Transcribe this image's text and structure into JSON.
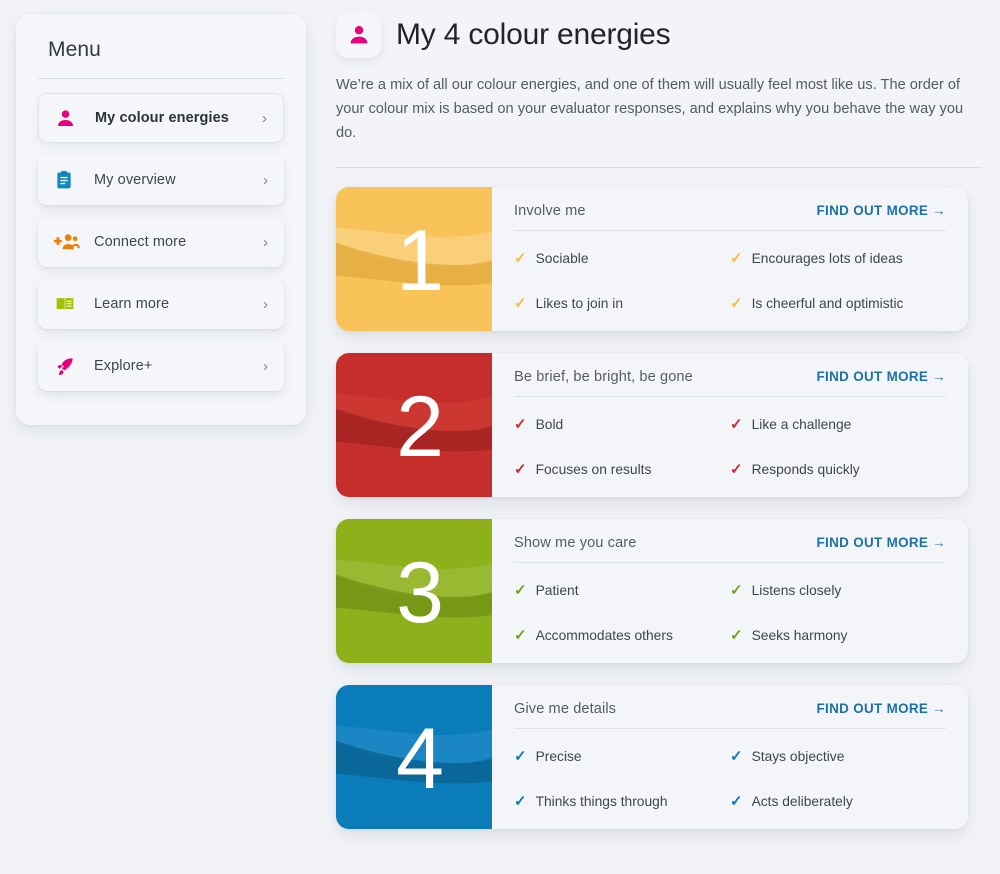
{
  "sidebar": {
    "title": "Menu",
    "items": [
      {
        "label": "My colour energies",
        "icon": "person-icon",
        "color": "#e6007e",
        "active": true,
        "chevron": "›"
      },
      {
        "label": "My overview",
        "icon": "clipboard-icon",
        "color": "#1287c0",
        "active": false,
        "chevron": "›"
      },
      {
        "label": "Connect more",
        "icon": "add-people-icon",
        "color": "#ef7d00",
        "active": false,
        "chevron": "›"
      },
      {
        "label": "Learn more",
        "icon": "open-book-icon",
        "color": "#a6bf00",
        "active": false,
        "chevron": "›"
      },
      {
        "label": "Explore+",
        "icon": "rocket-icon",
        "color": "#e6007e",
        "active": false,
        "chevron": "›"
      }
    ]
  },
  "header": {
    "badge_icon": "person-icon",
    "badge_icon_color": "#e6007e",
    "title": "My 4 colour energies",
    "intro": "We’re a mix of all our colour energies, and one of them will usually feel most like us. The order of your colour mix is based on your evaluator responses, and explains why you behave the way you do."
  },
  "find_out_more_label": "FIND OUT MORE →",
  "energies": [
    {
      "rank": "1",
      "title": "Involve me",
      "color": "#f8c459",
      "color_light": "#fbd385",
      "color_dark": "#e0a83c",
      "tick_color": "#f5bb3c",
      "traits": [
        "Sociable",
        "Encourages lots of ideas",
        "Likes to join in",
        "Is cheerful and optimistic"
      ]
    },
    {
      "rank": "2",
      "title": "Be brief, be bright, be gone",
      "color": "#c62e2c",
      "color_light": "#cf3b34",
      "color_dark": "#9d2220",
      "tick_color": "#c62e2c",
      "traits": [
        "Bold",
        "Like a challenge",
        "Focuses on results",
        "Responds quickly"
      ]
    },
    {
      "rank": "3",
      "title": "Show me you care",
      "color": "#8eb11b",
      "color_light": "#9cbc3c",
      "color_dark": "#6f8f16",
      "tick_color": "#76a416",
      "traits": [
        "Patient",
        "Listens closely",
        "Accommodates others",
        "Seeks harmony"
      ]
    },
    {
      "rank": "4",
      "title": "Give me details",
      "color": "#0a7cba",
      "color_light": "#2089c6",
      "color_dark": "#0b5f8e",
      "tick_color": "#0a7cba",
      "traits": [
        "Precise",
        "Stays objective",
        "Thinks things through",
        "Acts deliberately"
      ]
    }
  ]
}
